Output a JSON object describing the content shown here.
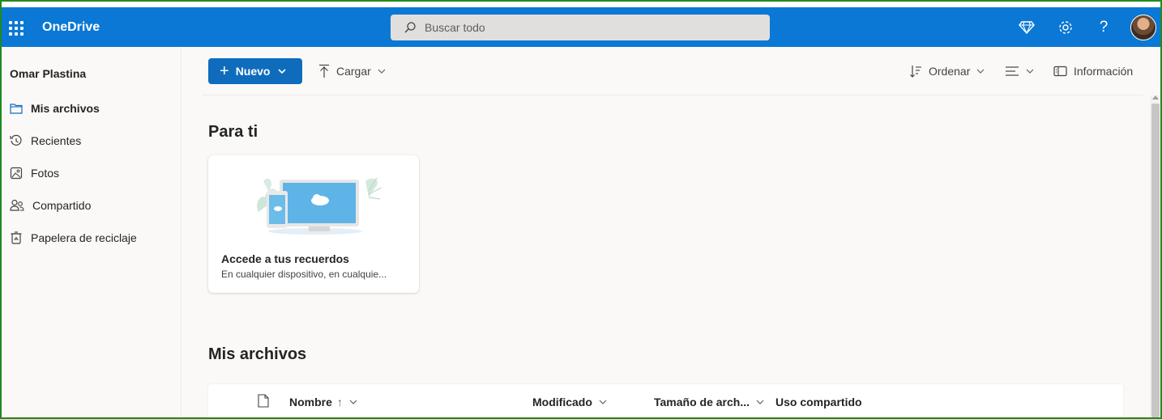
{
  "app": {
    "brand": "OneDrive",
    "search_placeholder": "Buscar todo"
  },
  "sidebar": {
    "user_name": "Omar Plastina",
    "items": [
      {
        "label": "Mis archivos",
        "icon": "folder-icon",
        "active": true
      },
      {
        "label": "Recientes",
        "icon": "history-icon",
        "active": false
      },
      {
        "label": "Fotos",
        "icon": "photo-icon",
        "active": false
      },
      {
        "label": "Compartido",
        "icon": "people-icon",
        "active": false
      },
      {
        "label": "Papelera de reciclaje",
        "icon": "recycle-bin-icon",
        "active": false
      }
    ]
  },
  "command_bar": {
    "new_label": "Nuevo",
    "upload_label": "Cargar",
    "sort_label": "Ordenar",
    "info_label": "Información"
  },
  "for_you": {
    "title": "Para ti",
    "card": {
      "title": "Accede a tus recuerdos",
      "subtitle": "En cualquier dispositivo, en cualquie..."
    }
  },
  "my_files": {
    "title": "Mis archivos",
    "columns": [
      "Nombre",
      "Modificado",
      "Tamaño de arch...",
      "Uso compartido"
    ]
  },
  "colors": {
    "topbar": "#0a78d4",
    "primary_button": "#0f6cbd",
    "frame": "#1f8a1f"
  }
}
